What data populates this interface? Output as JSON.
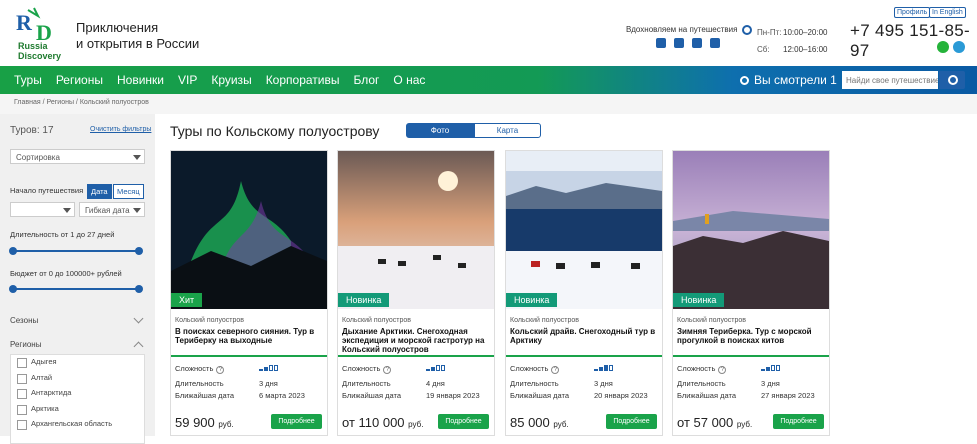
{
  "header": {
    "brand_line1": "Russia",
    "brand_line2": "Discovery",
    "slogan_line1": "Приключения",
    "slogan_line2": "и открытия в России",
    "inspire": "Вдохновляем на путешествия",
    "hours": [
      {
        "day": "Пн-Пт:",
        "time": "10:00–20:00"
      },
      {
        "day": "Сб:",
        "time": "12:00–16:00"
      }
    ],
    "phone": "+7 495 151-85-97",
    "profile_btn": "Профиль",
    "english_btn": "In English"
  },
  "nav": {
    "items": [
      "Туры",
      "Регионы",
      "Новинки",
      "VIP",
      "Круизы",
      "Корпоративы",
      "Блог",
      "О нас"
    ],
    "seen": "Вы смотрели 1",
    "search_placeholder": "Найди свое путешествие"
  },
  "breadcrumbs": "Главная / Регионы / Кольский полуостров",
  "sidebar": {
    "tours_count": "Туров: 17",
    "clear": "Очистить фильтры",
    "sort": "Сортировка",
    "start_label": "Начало путешествия",
    "date_btn": "Дата",
    "month_btn": "Месяц",
    "flex_date": "Гибкая дата",
    "duration": "Длительность от 1 до 27 дней",
    "budget": "Бюджет от 0 до 100000+ рублей",
    "seasons": "Сезоны",
    "regions": "Регионы",
    "region_items": [
      "Адыгея",
      "Алтай",
      "Антарктида",
      "Арктика",
      "Архангельская область"
    ]
  },
  "main": {
    "title": "Туры по Кольскому полуострову",
    "tab_photo": "Фото",
    "tab_map": "Карта"
  },
  "labels": {
    "difficulty": "Сложность",
    "duration": "Длительность",
    "nearest": "Ближайшая дата",
    "more": "Подробнее",
    "help": "?"
  },
  "cards": [
    {
      "badge": "Хит",
      "badge_color": "#1aa34a",
      "region": "Кольский полуостров",
      "title": "В поисках северного сияния. Тур в Териберку на выходные",
      "duration": "3 дня",
      "date": "6 марта 2023",
      "price": "59 900",
      "currency": "руб."
    },
    {
      "badge": "Новинка",
      "badge_color": "#139a78",
      "region": "Кольский полуостров",
      "title": "Дыхание Арктики. Снегоходная экспедиция и морской гастротур на Кольский полуостров",
      "duration": "4 дня",
      "date": "19 января 2023",
      "price": "от 110 000",
      "currency": "руб."
    },
    {
      "badge": "Новинка",
      "badge_color": "#139a78",
      "region": "Кольский полуостров",
      "title": "Кольский драйв. Снегоходный тур в Арктику",
      "duration": "3 дня",
      "date": "20 января 2023",
      "price": "85 000",
      "currency": "руб."
    },
    {
      "badge": "Новинка",
      "badge_color": "#139a78",
      "region": "Кольский полуостров",
      "title": "Зимняя Териберка. Тур с морской прогулкой в поисках китов",
      "duration": "3 дня",
      "date": "27 января 2023",
      "price": "от 57 000",
      "currency": "руб."
    }
  ]
}
